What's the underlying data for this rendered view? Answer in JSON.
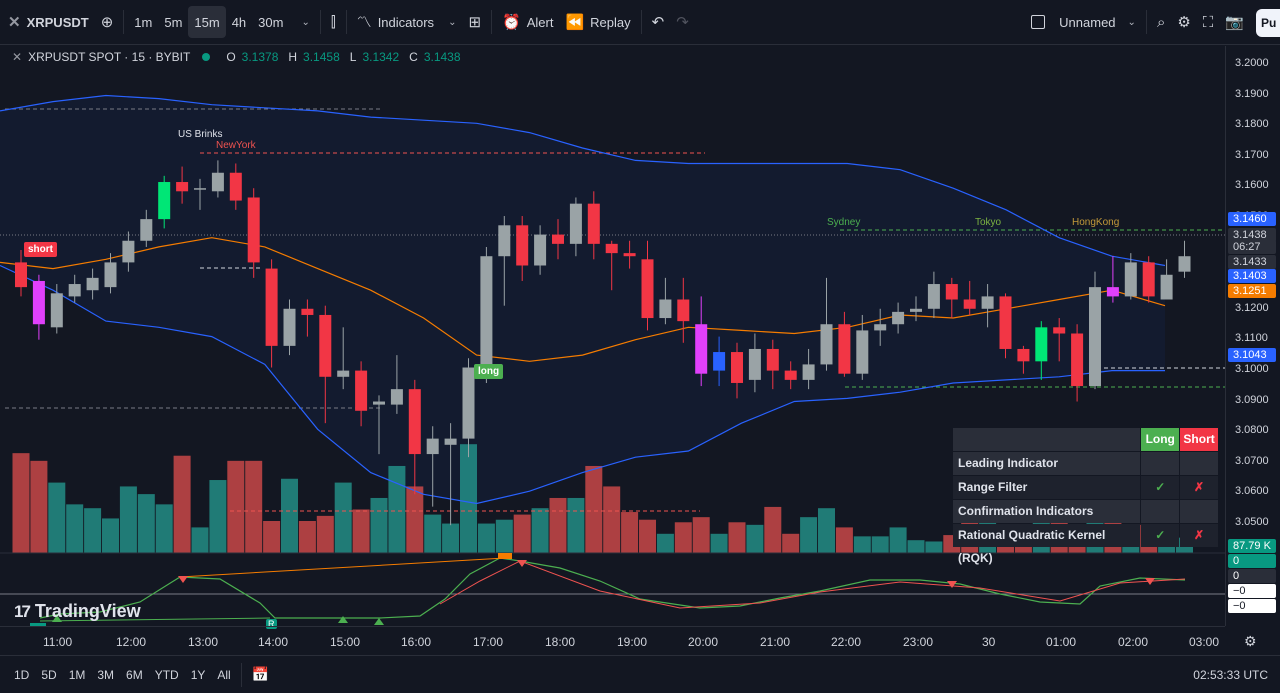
{
  "toolbar": {
    "symbol": "XRPUSDT",
    "intervals": [
      "1m",
      "5m",
      "15m",
      "4h",
      "30m"
    ],
    "active_interval": "15m",
    "indicators_label": "Indicators",
    "alert_label": "Alert",
    "replay_label": "Replay",
    "layout_name": "Unnamed",
    "publish_label": "Pu"
  },
  "legend": {
    "title": "XRPUSDT SPOT · 15 · BYBIT",
    "o_key": "O",
    "o": "3.1378",
    "h_key": "H",
    "h": "3.1458",
    "l_key": "L",
    "l": "3.1342",
    "c_key": "C",
    "c": "3.1438"
  },
  "price_scale": {
    "ticks": [
      "3.2000",
      "3.1900",
      "3.1800",
      "3.1700",
      "3.1600",
      "3.1500",
      "3.1400",
      "3.1300",
      "3.1200",
      "3.1100",
      "3.1000",
      "3.0900",
      "3.0800",
      "3.0700",
      "3.0600",
      "3.0500"
    ],
    "labels": {
      "upper_band": "3.1460",
      "last_price": "3.1438",
      "countdown": "06:27",
      "prev": "3.1433",
      "basis": "3.1403",
      "ma": "3.1251",
      "lower_band": "3.1043",
      "volume": "87.79 K"
    },
    "osc_labels": [
      "0",
      "0",
      "−0",
      "−0"
    ]
  },
  "time_axis": [
    "11:00",
    "12:00",
    "13:00",
    "14:00",
    "15:00",
    "16:00",
    "17:00",
    "18:00",
    "19:00",
    "20:00",
    "21:00",
    "22:00",
    "23:00",
    "30",
    "01:00",
    "02:00",
    "03:00"
  ],
  "bottom_bar": {
    "ranges": [
      "1D",
      "5D",
      "1M",
      "3M",
      "6M",
      "YTD",
      "1Y",
      "All"
    ],
    "clock": "02:53:33 UTC"
  },
  "annotations": {
    "us_brinks": "US Brinks",
    "newyork": "NewYork",
    "sydney": "Sydney",
    "tokyo": "Tokyo",
    "hongkong": "HongKong",
    "short_tag": "short",
    "long_tag": "long",
    "osc_marker": "R"
  },
  "watermark": "TradingView",
  "signal_table": {
    "long_header": "Long",
    "short_header": "Short",
    "rows": [
      {
        "label": "Leading Indicator",
        "section": true
      },
      {
        "label": "Range Filter",
        "long": "✓",
        "short": "✗"
      },
      {
        "label": "Confirmation Indicators",
        "section": true
      },
      {
        "label": "Rational Quadratic Kernel (RQK)",
        "long": "✓",
        "short": "✗"
      }
    ]
  },
  "colors": {
    "bull": "#9aa3a6",
    "bear": "#f23645",
    "green_candle": "#00e676",
    "magenta_candle": "#e040fb",
    "blue_candle": "#2962ff",
    "band": "#2962ff",
    "basis": "#f57c00",
    "vol_up": "#26a69a",
    "vol_down": "#ef5350"
  },
  "chart_data": {
    "type": "candlestick",
    "price_range": [
      3.045,
      3.2035
    ],
    "candles": [
      [
        3.139,
        3.131,
        3.143,
        3.128
      ],
      [
        3.133,
        3.119,
        3.135,
        3.114
      ],
      [
        3.118,
        3.129,
        3.132,
        3.116
      ],
      [
        3.128,
        3.132,
        3.135,
        3.126
      ],
      [
        3.13,
        3.134,
        3.137,
        3.127
      ],
      [
        3.131,
        3.139,
        3.142,
        3.129
      ],
      [
        3.139,
        3.146,
        3.149,
        3.136
      ],
      [
        3.146,
        3.153,
        3.156,
        3.144
      ],
      [
        3.153,
        3.165,
        3.167,
        3.15
      ],
      [
        3.165,
        3.162,
        3.17,
        3.158
      ],
      [
        3.163,
        3.163,
        3.166,
        3.156
      ],
      [
        3.162,
        3.168,
        3.172,
        3.16
      ],
      [
        3.168,
        3.159,
        3.171,
        3.156
      ],
      [
        3.16,
        3.139,
        3.163,
        3.134
      ],
      [
        3.137,
        3.112,
        3.14,
        3.105
      ],
      [
        3.112,
        3.124,
        3.127,
        3.109
      ],
      [
        3.124,
        3.122,
        3.127,
        3.115
      ],
      [
        3.122,
        3.102,
        3.125,
        3.087
      ],
      [
        3.102,
        3.104,
        3.118,
        3.098
      ],
      [
        3.104,
        3.091,
        3.107,
        3.086
      ],
      [
        3.093,
        3.094,
        3.096,
        3.077
      ],
      [
        3.093,
        3.098,
        3.109,
        3.09
      ],
      [
        3.098,
        3.077,
        3.101,
        3.064
      ],
      [
        3.077,
        3.082,
        3.086,
        3.06
      ],
      [
        3.08,
        3.082,
        3.087,
        3.054
      ],
      [
        3.082,
        3.105,
        3.108,
        3.076
      ],
      [
        3.105,
        3.141,
        3.144,
        3.1
      ],
      [
        3.141,
        3.151,
        3.154,
        3.125
      ],
      [
        3.151,
        3.138,
        3.154,
        3.133
      ],
      [
        3.138,
        3.148,
        3.151,
        3.135
      ],
      [
        3.148,
        3.145,
        3.153,
        3.14
      ],
      [
        3.145,
        3.158,
        3.16,
        3.141
      ],
      [
        3.158,
        3.145,
        3.162,
        3.14
      ],
      [
        3.145,
        3.142,
        3.146,
        3.13
      ],
      [
        3.142,
        3.141,
        3.146,
        3.137
      ],
      [
        3.14,
        3.121,
        3.146,
        3.117
      ],
      [
        3.121,
        3.127,
        3.134,
        3.119
      ],
      [
        3.127,
        3.12,
        3.134,
        3.113
      ],
      [
        3.119,
        3.103,
        3.128,
        3.099
      ],
      [
        3.104,
        3.11,
        3.115,
        3.099
      ],
      [
        3.11,
        3.1,
        3.113,
        3.095
      ],
      [
        3.101,
        3.111,
        3.116,
        3.097
      ],
      [
        3.111,
        3.104,
        3.114,
        3.098
      ],
      [
        3.104,
        3.101,
        3.107,
        3.098
      ],
      [
        3.101,
        3.106,
        3.111,
        3.098
      ],
      [
        3.106,
        3.119,
        3.134,
        3.104
      ],
      [
        3.119,
        3.103,
        3.123,
        3.102
      ],
      [
        3.103,
        3.117,
        3.122,
        3.101
      ],
      [
        3.117,
        3.119,
        3.124,
        3.112
      ],
      [
        3.119,
        3.123,
        3.126,
        3.116
      ],
      [
        3.123,
        3.124,
        3.128,
        3.12
      ],
      [
        3.124,
        3.132,
        3.136,
        3.121
      ],
      [
        3.132,
        3.127,
        3.134,
        3.121
      ],
      [
        3.127,
        3.124,
        3.133,
        3.122
      ],
      [
        3.124,
        3.128,
        3.132,
        3.118
      ],
      [
        3.128,
        3.111,
        3.129,
        3.108
      ],
      [
        3.111,
        3.107,
        3.112,
        3.103
      ],
      [
        3.107,
        3.118,
        3.12,
        3.101
      ],
      [
        3.118,
        3.116,
        3.121,
        3.107
      ],
      [
        3.116,
        3.099,
        3.119,
        3.094
      ],
      [
        3.099,
        3.131,
        3.136,
        3.098
      ],
      [
        3.131,
        3.128,
        3.141,
        3.126
      ],
      [
        3.128,
        3.139,
        3.142,
        3.127
      ],
      [
        3.139,
        3.128,
        3.141,
        3.126
      ],
      [
        3.127,
        3.135,
        3.14,
        3.128
      ],
      [
        3.136,
        3.141,
        3.146,
        3.134
      ]
    ],
    "upper_band": [
      3.188,
      3.191,
      3.193,
      3.192,
      3.19,
      3.189,
      3.188,
      3.186,
      3.185,
      3.184,
      3.181,
      3.176,
      3.172,
      3.171,
      3.171,
      3.171,
      3.171,
      3.169,
      3.163,
      3.156,
      3.147,
      3.141,
      3.138
    ],
    "basis": [
      3.139,
      3.137,
      3.14,
      3.144,
      3.147,
      3.144,
      3.137,
      3.13,
      3.121,
      3.109,
      3.107,
      3.109,
      3.114,
      3.118,
      3.117,
      3.116,
      3.118,
      3.122,
      3.121,
      3.124,
      3.127,
      3.13,
      3.125
    ],
    "lower_band": [
      3.138,
      3.13,
      3.12,
      3.118,
      3.115,
      3.106,
      3.085,
      3.071,
      3.064,
      3.061,
      3.065,
      3.071,
      3.076,
      3.078,
      3.087,
      3.094,
      3.095,
      3.097,
      3.1,
      3.101,
      3.102,
      3.104,
      3.104
    ],
    "volume_relative": [
      0.78,
      0.72,
      0.55,
      0.38,
      0.35,
      0.27,
      0.52,
      0.46,
      0.38,
      0.76,
      0.2,
      0.57,
      0.72,
      0.72,
      0.25,
      0.58,
      0.25,
      0.29,
      0.55,
      0.34,
      0.43,
      0.68,
      0.52,
      0.3,
      0.23,
      0.85,
      0.23,
      0.26,
      0.3,
      0.35,
      0.43,
      0.43,
      0.68,
      0.52,
      0.32,
      0.26,
      0.15,
      0.24,
      0.28,
      0.15,
      0.24,
      0.22,
      0.36,
      0.15,
      0.28,
      0.35,
      0.2,
      0.13,
      0.13,
      0.2,
      0.1,
      0.09,
      0.14,
      0.25,
      0.3,
      0.17,
      0.1,
      0.28,
      0.24,
      0.22,
      0.24,
      0.3,
      0.15,
      0.22,
      0.11,
      0.12
    ]
  }
}
